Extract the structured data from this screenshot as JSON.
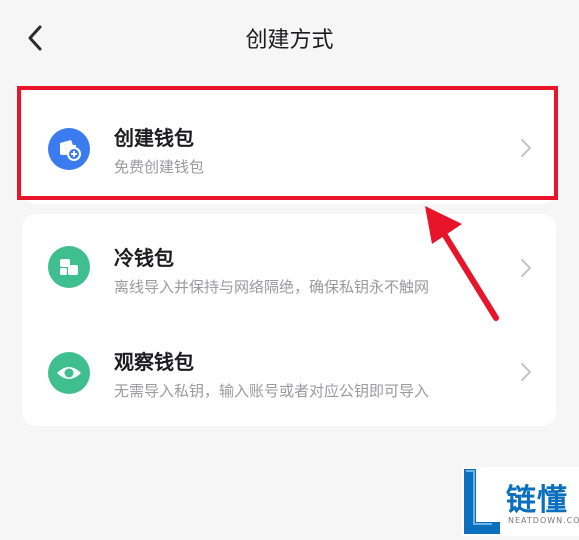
{
  "header": {
    "title": "创建方式"
  },
  "options": [
    {
      "title": "创建钱包",
      "subtitle": "免费创建钱包",
      "icon": "wallet-add-icon",
      "color": "#3a7bf0"
    },
    {
      "title": "冷钱包",
      "subtitle": "离线导入并保持与网络隔绝，确保私钥永不触网",
      "icon": "cold-wallet-icon",
      "color": "#3fbf8f"
    },
    {
      "title": "观察钱包",
      "subtitle": "无需导入私钥，输入账号或者对应公钥即可导入",
      "icon": "eye-icon",
      "color": "#3fbf8f"
    }
  ],
  "watermark": {
    "text": "链懂",
    "sub": "NEATDOWN.COM"
  }
}
